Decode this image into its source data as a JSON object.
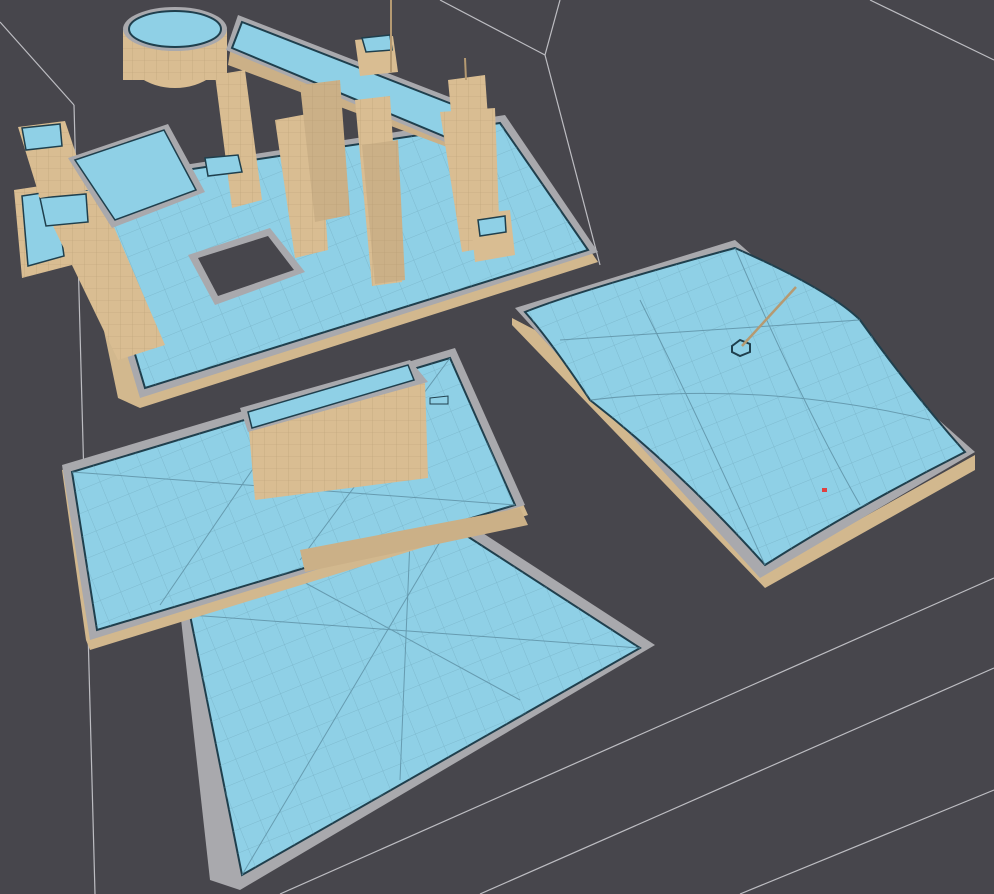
{
  "viewport": {
    "name": "3d-viewport",
    "background": "#47464c",
    "colors": {
      "grid_line": "#bdbdc2",
      "navmesh_fill": "#8fd0e6",
      "navmesh_edge": "#1f3f4d",
      "navmesh_tri": "#5c8fa3",
      "geometry_top": "#cbb087",
      "geometry_side": "#d9bd92",
      "geometry_dark": "#b59a72",
      "ground_border": "#a9a9ad",
      "ground_side": "#d2b88e",
      "marker": "#e04040"
    }
  },
  "scene_objects": [
    {
      "name": "navmesh-floor-ruins",
      "kind": "navigation-mesh"
    },
    {
      "name": "navmesh-floor-ramp",
      "kind": "navigation-mesh"
    },
    {
      "name": "navmesh-floor-terrain",
      "kind": "navigation-mesh"
    },
    {
      "name": "navigation-agent-marker",
      "kind": "agent"
    }
  ]
}
